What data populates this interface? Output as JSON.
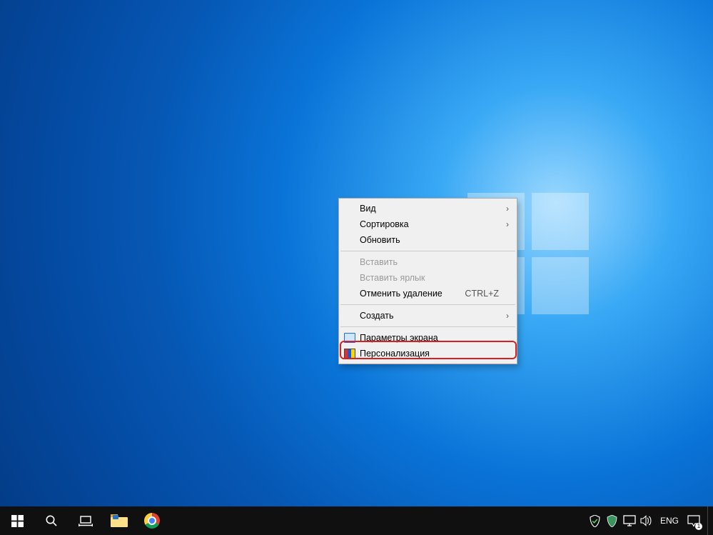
{
  "context_menu": {
    "items": [
      {
        "label": "Вид",
        "submenu": true
      },
      {
        "label": "Сортировка",
        "submenu": true
      },
      {
        "label": "Обновить"
      }
    ],
    "group2": [
      {
        "label": "Вставить",
        "disabled": true
      },
      {
        "label": "Вставить ярлык",
        "disabled": true
      },
      {
        "label": "Отменить удаление",
        "shortcut": "CTRL+Z"
      }
    ],
    "group3": [
      {
        "label": "Создать",
        "submenu": true
      }
    ],
    "group4": [
      {
        "label": "Параметры экрана",
        "icon": "display"
      },
      {
        "label": "Персонализация",
        "icon": "personal",
        "highlighted": true
      }
    ]
  },
  "taskbar": {
    "apps": {
      "file_explorer": "file-explorer",
      "chrome": "chrome"
    },
    "tray": {
      "language": "ENG"
    }
  }
}
